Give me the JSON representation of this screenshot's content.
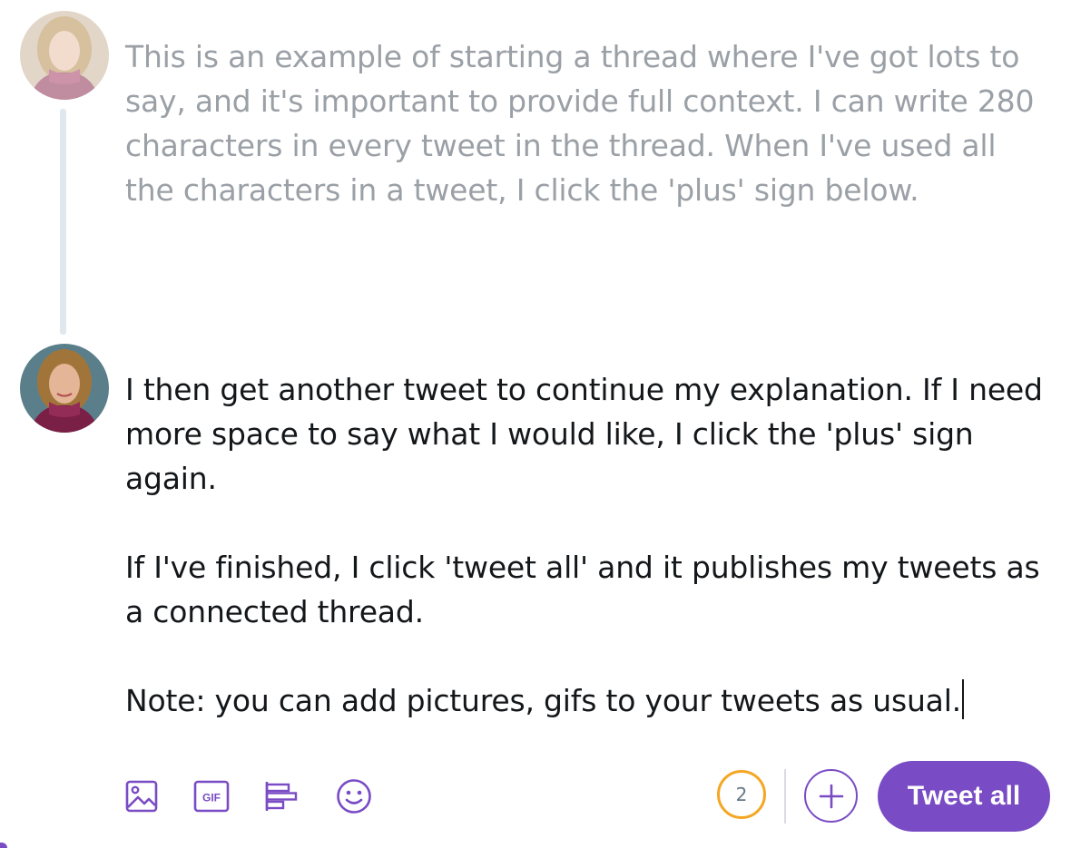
{
  "thread": {
    "tweets": [
      {
        "text": "This is an example of starting a thread where I've got lots to say, and it's important to provide full context. I can write 280 characters in every tweet in the thread. When I've used all the characters in a tweet, I click the 'plus' sign below.",
        "state": "inactive"
      },
      {
        "text": "I then get another tweet to continue my explanation. If I need more space to say what I would like, I click the 'plus' sign again.\n\nIf I've finished, I click 'tweet all' and it publishes my tweets as a connected thread.\n\nNote: you can add pictures, gifs to your tweets as usual.",
        "state": "active"
      }
    ]
  },
  "toolbar": {
    "icons": [
      "image-icon",
      "gif-icon",
      "poll-icon",
      "emoji-icon"
    ],
    "counter_value": "2",
    "tweet_all_label": "Tweet all"
  },
  "colors": {
    "accent": "#794bc4",
    "counter_ring": "#f5a623",
    "thread_line": "#e1e8ed",
    "inactive_text": "#9aa0a6",
    "active_text": "#14171a"
  }
}
